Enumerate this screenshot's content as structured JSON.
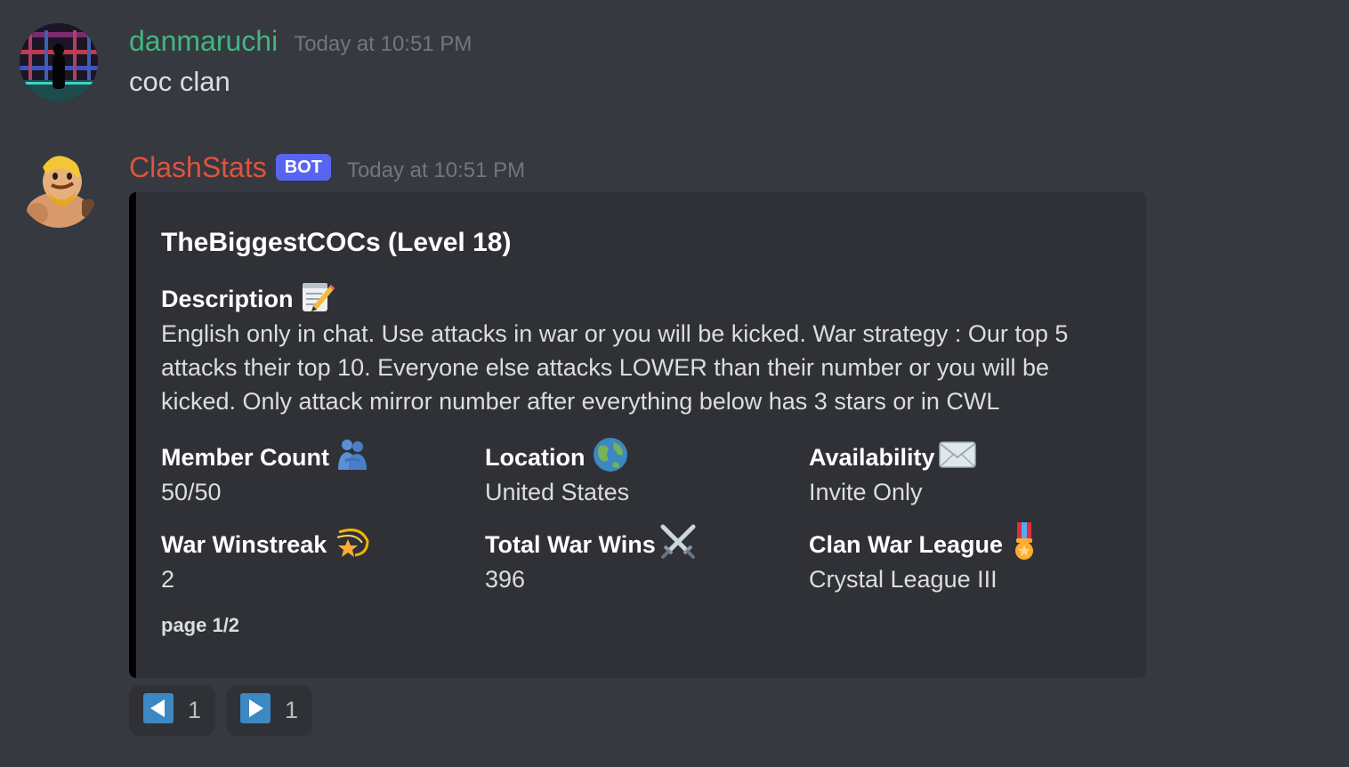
{
  "messages": [
    {
      "username": "danmaruchi",
      "timestamp": "Today at 10:51 PM",
      "content": "coc clan",
      "avatar_icon": "user-avatar-icon",
      "name_color": "#43b581"
    },
    {
      "username": "ClashStats",
      "bot_tag": "BOT",
      "timestamp": "Today at 10:51 PM",
      "avatar_icon": "barbarian-avatar-icon",
      "name_color": "#e0533d"
    }
  ],
  "embed": {
    "title": "TheBiggestCOCs (Level 18)",
    "description": {
      "name": "Description",
      "icon": "memo-icon",
      "value": "English only in chat. Use attacks in war or you will be kicked. War strategy : Our top 5 attacks their top 10. Everyone else attacks LOWER than their number or you will be kicked. Only attack mirror number after everything below has 3 stars or in CWL"
    },
    "fields": [
      {
        "name": "Member Count",
        "icon": "people-hugging-icon",
        "value": "50/50"
      },
      {
        "name": "Location",
        "icon": "globe-icon",
        "value": "United States"
      },
      {
        "name": "Availability",
        "icon": "envelope-icon",
        "value": "Invite Only"
      },
      {
        "name": "War Winstreak",
        "icon": "dizzy-star-icon",
        "value": "2"
      },
      {
        "name": "Total War Wins",
        "icon": "crossed-swords-icon",
        "value": "396"
      },
      {
        "name": "Clan War League",
        "icon": "military-medal-icon",
        "value": "Crystal League III"
      }
    ],
    "footer": "page 1/2",
    "border_color": "#000000"
  },
  "reactions": [
    {
      "icon": "left-arrow-icon",
      "count": "1"
    },
    {
      "icon": "right-arrow-icon",
      "count": "1"
    }
  ]
}
